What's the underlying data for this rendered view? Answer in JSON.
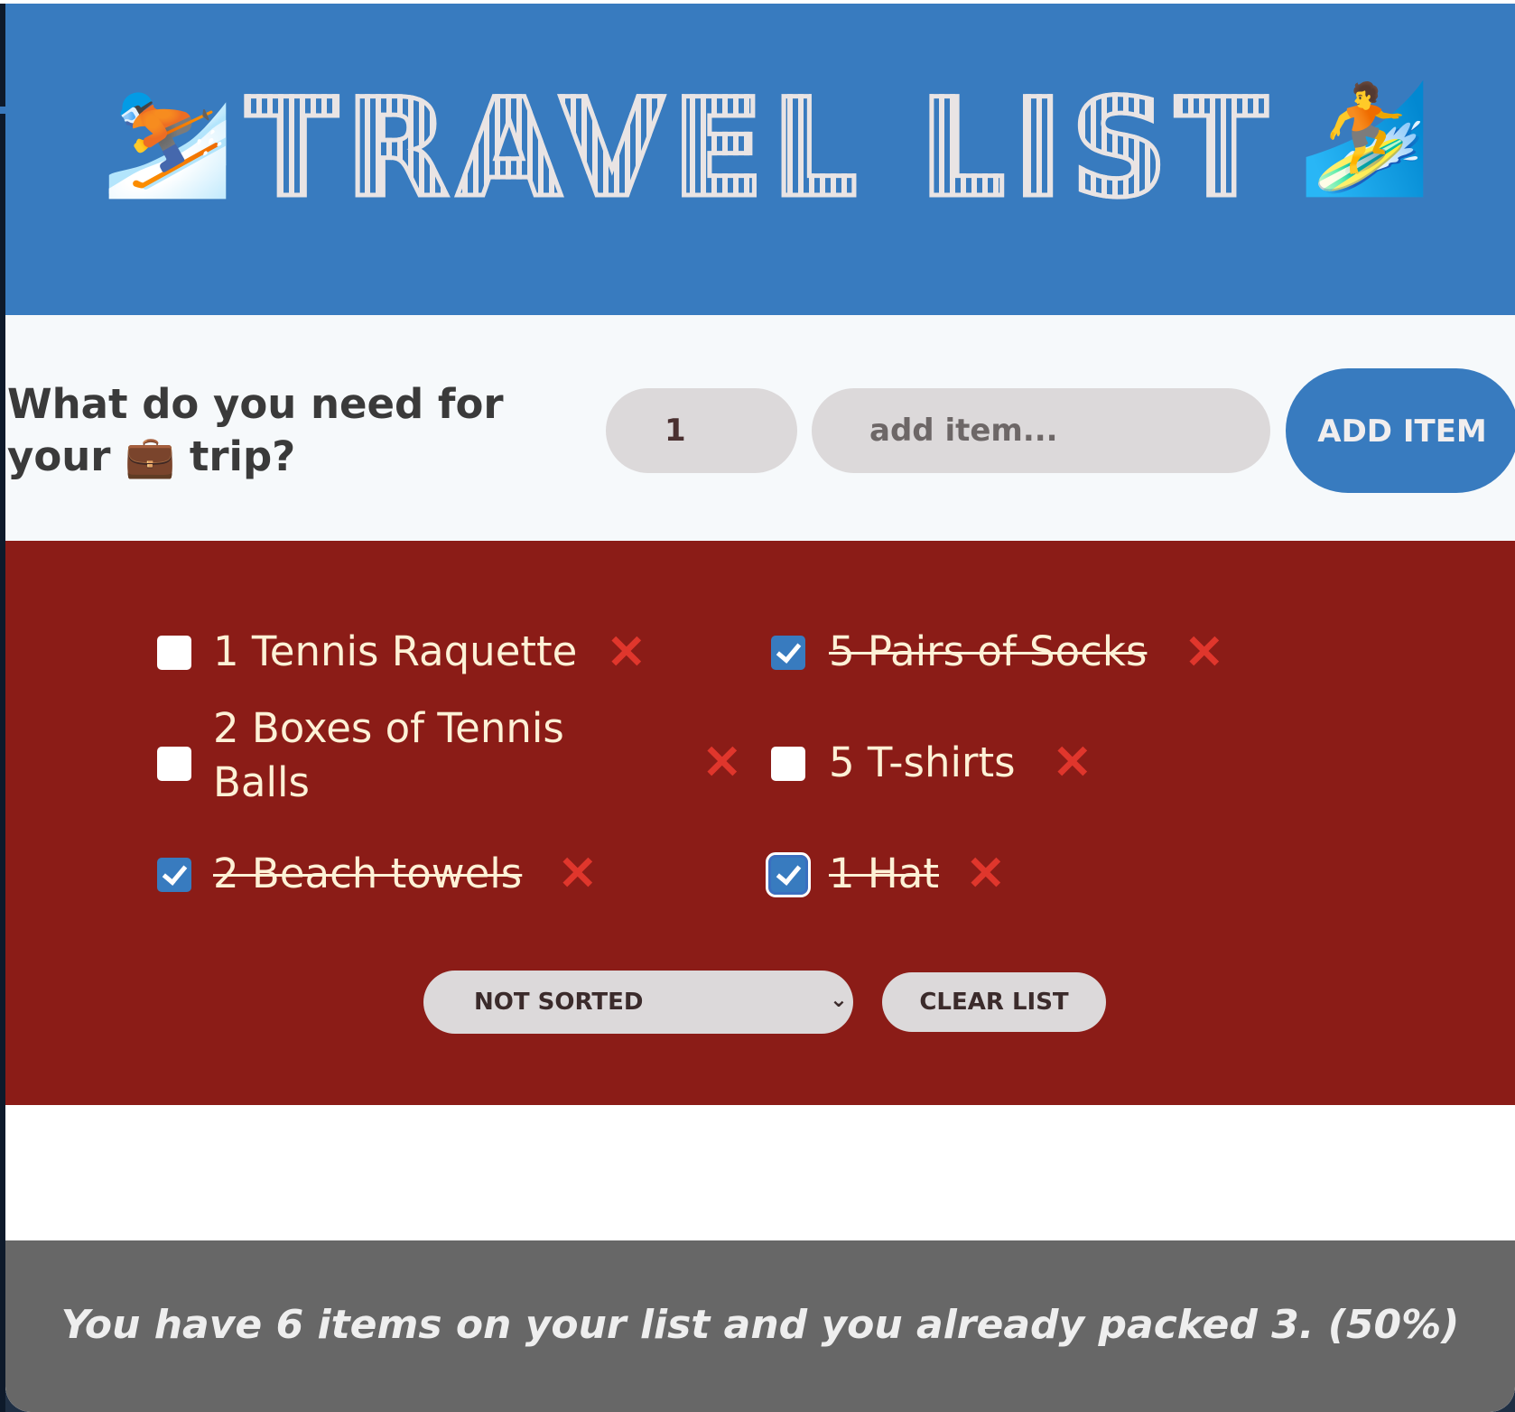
{
  "header": {
    "title": "TRAVEL LIST",
    "left_emoji": "⛷️",
    "right_emoji": "🏄"
  },
  "form": {
    "prompt": "What do you need for your 💼 trip?",
    "quantity": "1",
    "item_placeholder": "add item...",
    "add_button": "ADD ITEM"
  },
  "items": [
    {
      "label": "1 Tennis Raquette",
      "packed": false
    },
    {
      "label": "5 Pairs of Socks",
      "packed": true
    },
    {
      "label": "2 Boxes of Tennis Balls",
      "packed": false
    },
    {
      "label": "5 T-shirts",
      "packed": false
    },
    {
      "label": "2 Beach towels",
      "packed": true
    },
    {
      "label": "1 Hat",
      "packed": true
    }
  ],
  "actions": {
    "sort_selected": "NOT SORTED",
    "clear_button": "CLEAR LIST",
    "delete_glyph": "❌"
  },
  "stats": {
    "text": "You have 6 items on your list and you already packed 3. (50%)"
  },
  "colors": {
    "header_bg": "#387bbf",
    "list_bg": "#8b1c17",
    "stats_bg": "#676767",
    "accent": "#387bbf",
    "delete": "#e0362c"
  }
}
